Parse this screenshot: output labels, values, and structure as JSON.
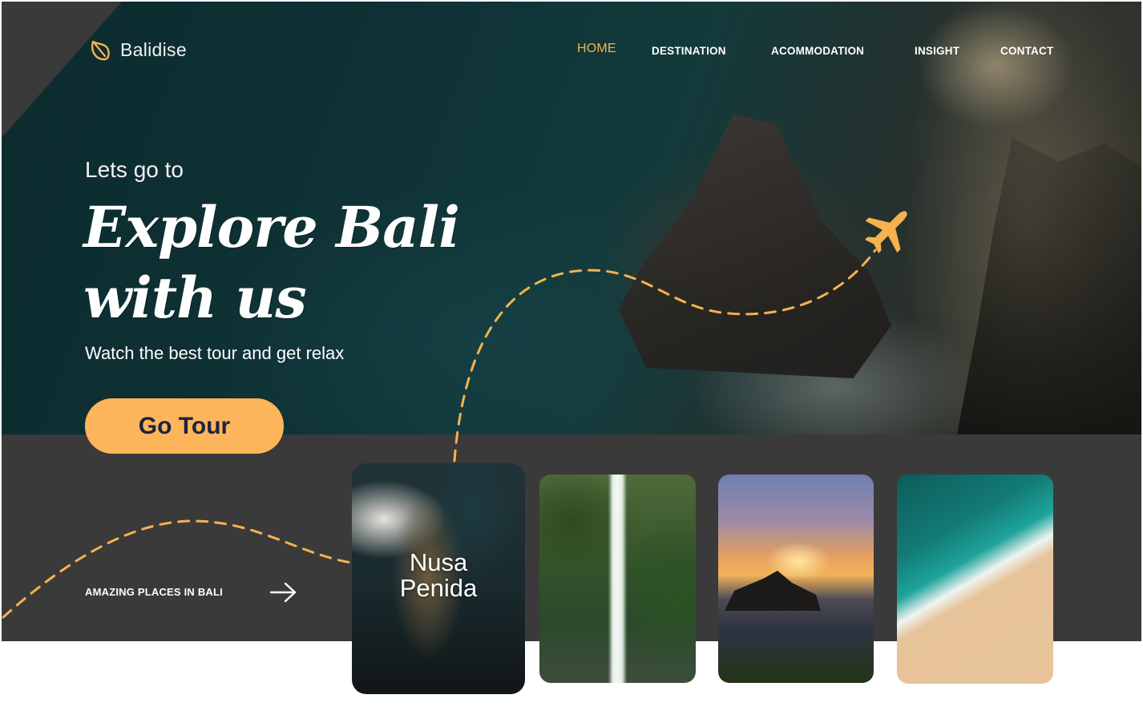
{
  "brand": {
    "name": "Balidise",
    "icon": "leaf-icon"
  },
  "nav": {
    "items": [
      {
        "label": "HOME",
        "active": true
      },
      {
        "label": "DESTINATION",
        "active": false
      },
      {
        "label": "ACOMMODATION",
        "active": false
      },
      {
        "label": "INSIGHT",
        "active": false
      },
      {
        "label": "CONTACT",
        "active": false
      }
    ]
  },
  "hero": {
    "kicker": "Lets go to",
    "headline_line1": "Explore Bali",
    "headline_line2": "with us",
    "subline": "Watch the best tour and get relax",
    "cta_label": "Go Tour",
    "plane_icon": "airplane-icon"
  },
  "places": {
    "label": "AMAZING PLACES IN BALI",
    "arrow_icon": "arrow-right-icon",
    "cards": [
      {
        "title": "Nusa Penida",
        "title_line1": "Nusa",
        "title_line2": "Penida",
        "image": "aerial-coast-image"
      },
      {
        "title": "",
        "image": "waterfall-image"
      },
      {
        "title": "",
        "image": "temple-sunset-image"
      },
      {
        "title": "",
        "image": "beach-aerial-image"
      }
    ]
  },
  "colors": {
    "accent": "#f6b24e",
    "button": "#fdb55b",
    "button_text": "#1c2340",
    "band": "#3a3a3a"
  }
}
